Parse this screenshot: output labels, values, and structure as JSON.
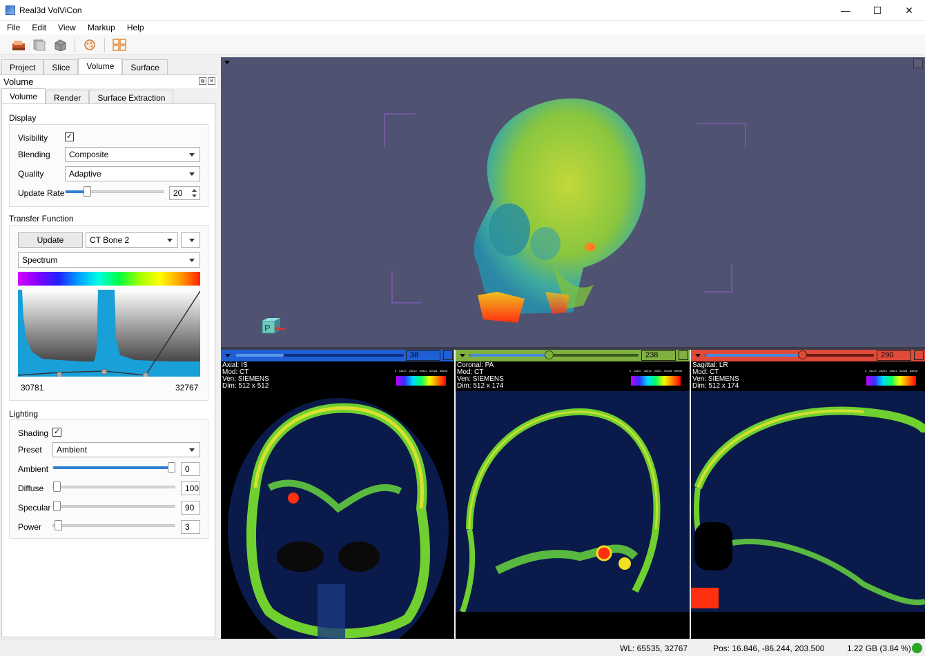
{
  "window": {
    "title": "Real3d VolViCon",
    "minimize": "—",
    "maximize": "☐",
    "close": "✕"
  },
  "menu": [
    "File",
    "Edit",
    "View",
    "Markup",
    "Help"
  ],
  "toolbar": {
    "icons": [
      "open-volume-icon",
      "slice-stack-icon",
      "volume-cube-icon",
      "color-palette-icon",
      "layout-icon"
    ]
  },
  "left_tabs": [
    "Project",
    "Slice",
    "Volume",
    "Surface"
  ],
  "dock_title": "Volume",
  "sub_tabs": [
    "Volume",
    "Render",
    "Surface Extraction"
  ],
  "display": {
    "section": "Display",
    "visibility_label": "Visibility",
    "visibility_checked": "✓",
    "blending_label": "Blending",
    "blending_value": "Composite",
    "quality_label": "Quality",
    "quality_value": "Adaptive",
    "update_rate_label": "Update Rate",
    "update_rate_value": "20"
  },
  "transfer_function": {
    "section": "Transfer Function",
    "update_button": "Update",
    "preset_value": "CT Bone 2",
    "colormap_value": "Spectrum",
    "range_min": "30781",
    "range_max": "32767"
  },
  "lighting": {
    "section": "Lighting",
    "shading_label": "Shading",
    "shading_checked": "✓",
    "preset_label": "Preset",
    "preset_value": "Ambient",
    "ambient_label": "Ambient",
    "ambient_value": "0",
    "diffuse_label": "Diffuse",
    "diffuse_value": "100",
    "specular_label": "Specular",
    "specular_value": "90",
    "power_label": "Power",
    "power_value": "3"
  },
  "slices": {
    "axial": {
      "line1": "Axial: IS",
      "line2": "Mod: CT",
      "line3": "Ven: SIEMENS",
      "line4": "Dim: 512 x 512",
      "slice": "38",
      "color": "#1f5fd6"
    },
    "coronal": {
      "line1": "Coronal: PA",
      "line2": "Mod: CT",
      "line3": "Ven: SIEMENS",
      "line4": "Dim: 512 x 174",
      "slice": "238",
      "color": "#7fb040"
    },
    "sagittal": {
      "line1": "Sagittal: LR",
      "line2": "Mod: CT",
      "line3": "Ven: SIEMENS",
      "line4": "Dim: 512 x 174",
      "slice": "290",
      "color": "#e04a3a"
    }
  },
  "colorbar_ticks": [
    "0",
    "13107",
    "26214",
    "39321",
    "52428",
    "65535"
  ],
  "status": {
    "wl": "WL: 65535, 32767",
    "pos": "Pos: 16.846, -86.244, 203.500",
    "memory": "1.22 GB (3.84 %)"
  }
}
